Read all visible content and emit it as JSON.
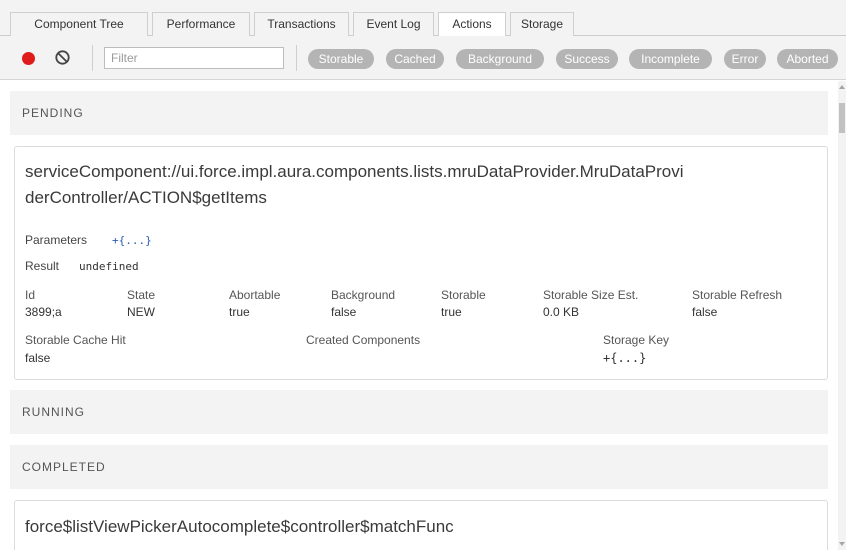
{
  "tabs": [
    {
      "label": "Component Tree"
    },
    {
      "label": "Performance"
    },
    {
      "label": "Transactions"
    },
    {
      "label": "Event Log"
    },
    {
      "label": "Actions",
      "active": true
    },
    {
      "label": "Storage"
    }
  ],
  "toolbar": {
    "record_icon": "record-icon",
    "clear_icon": "clear-icon",
    "filter_placeholder": "Filter",
    "filter_value": "",
    "pills": [
      "Storable",
      "Cached",
      "Background",
      "Success",
      "Incomplete",
      "Error",
      "Aborted"
    ],
    "pill_color": "#b4b4b4",
    "record_color": "#e01b1b"
  },
  "sections": {
    "pending": "PENDING",
    "running": "RUNNING",
    "completed": "COMPLETED"
  },
  "pending_action": {
    "name_line1": "serviceComponent://ui.force.impl.aura.components.lists.mruDataProvider.MruDataProvi",
    "name_line2": "derController/ACTION$getItems",
    "parameters_label": "Parameters",
    "parameters_value": "+{...}",
    "result_label": "Result",
    "result_value": "undefined",
    "columns": [
      {
        "header": "Id",
        "value": "3899;a"
      },
      {
        "header": "State",
        "value": "NEW"
      },
      {
        "header": "Abortable",
        "value": "true"
      },
      {
        "header": "Background",
        "value": "false"
      },
      {
        "header": "Storable",
        "value": "true"
      },
      {
        "header": "Storable Size Est.",
        "value": "0.0 KB"
      },
      {
        "header": "Storable Refresh",
        "value": "false"
      }
    ],
    "row2": {
      "cache_hit_label": "Storable Cache Hit",
      "cache_hit_value": "false",
      "created_label": "Created Components",
      "storage_key_label": "Storage Key",
      "storage_key_value": "+{...}"
    }
  },
  "completed_action": {
    "name": "force$listViewPickerAutocomplete$controller$matchFunc"
  }
}
